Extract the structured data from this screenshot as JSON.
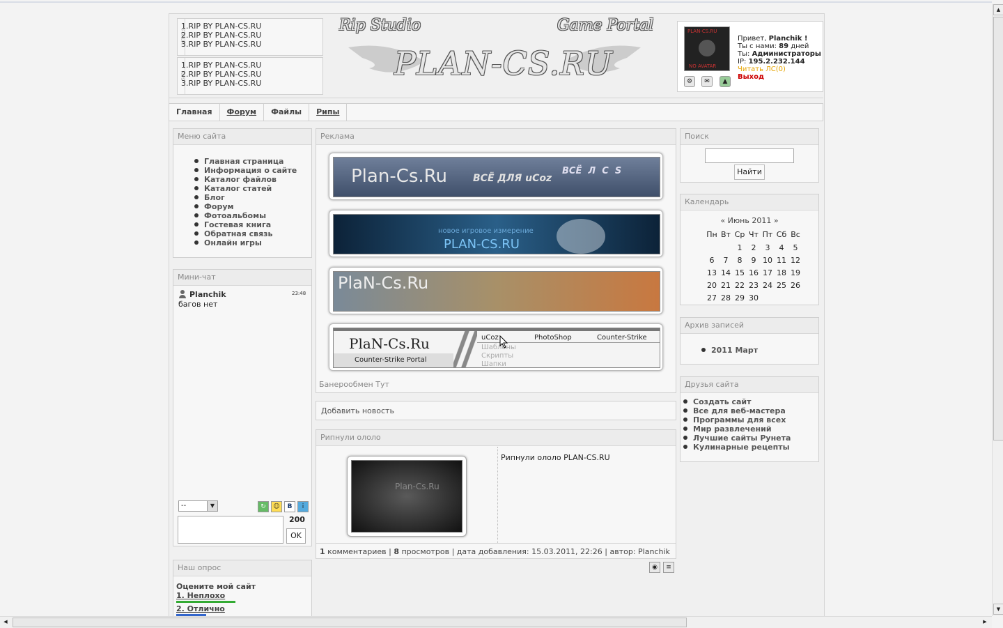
{
  "rip_blocks": [
    {
      "side": "FORUM",
      "lines": [
        "1.RIP BY PLAN-CS.RU",
        "2.RIP BY PLAN-CS.RU",
        "3.RIP BY PLAN-CS.RU"
      ]
    },
    {
      "side": "RIPS",
      "lines": [
        "1.RIP BY PLAN-CS.RU",
        "2.RIP BY PLAN-CS.RU",
        "3.RIP BY PLAN-CS.RU"
      ]
    }
  ],
  "logo": {
    "left": "Rip Studio",
    "right": "Game Portal",
    "main": "PLAN-CS.RU"
  },
  "user": {
    "avatar_top": "PLAN-CS.RU",
    "avatar_bottom": "NO AVATAR",
    "greeting": "Привет,",
    "name": "Planchik !",
    "with_us_label": "Ты с нами:",
    "with_us_days": "89",
    "with_us_unit": "дней",
    "role_label": "Ты:",
    "role": "Администраторы",
    "ip_label": "IP:",
    "ip": "195.2.232.144",
    "read_pm": "Читать ЛС(0)",
    "logout": "Выход"
  },
  "nav": [
    "Главная",
    "Форум",
    "Файлы",
    "Рипы"
  ],
  "site_menu": {
    "title": "Меню сайта",
    "items": [
      "Главная страница",
      "Информация о сайте",
      "Каталог файлов",
      "Каталог статей",
      "Блог",
      "Форум",
      "Фотоальбомы",
      "Гостевая книга",
      "Обратная связь",
      "Онлайн игры"
    ]
  },
  "minichat": {
    "title": "Мини-чат",
    "user": "Planchik",
    "time": "23:48",
    "message": "багов нет",
    "select": "--",
    "counter": "200",
    "ok": "OK"
  },
  "poll": {
    "title": "Наш опрос",
    "question": "Оцените мой сайт",
    "answers": [
      "1. Неплохо",
      "2. Отлично"
    ],
    "bars": [
      0.55,
      0.28
    ]
  },
  "ads": {
    "title": "Реклама",
    "b1_main": "Plan-Cs.Ru",
    "b1_tag": "ВСЁ ДЛЯ uCoz",
    "b1_letters": "ВСЁ  Л  С  S",
    "b2_sub": "новое игровое измерение",
    "b2_main": "PLAN-CS.RU",
    "b3_main": "PlaN-Cs.Ru",
    "b4_main": "PlaN-Cs.Ru",
    "b4_sub": "Counter-Strike Portal",
    "b4_tabs": [
      "uCoz",
      "PhotoShop",
      "Counter-Strike"
    ],
    "b4_list": [
      "Шаблоны",
      "Скрипты",
      "Шапки"
    ],
    "exchange": "Банерообмен Тут"
  },
  "add_news": "Добавить новость",
  "news": {
    "title": "Рипнули ололо",
    "text": "Рипнули ололо PLAN-CS.RU",
    "thumb_text": "Plan-Cs.Ru",
    "comments": "1",
    "comments_label": "комментариев",
    "views": "8",
    "views_label": "просмотров",
    "date_label": "дата добавления:",
    "date": "15.03.2011, 22:26",
    "author_label": "автор:",
    "author": "Planchik"
  },
  "search": {
    "title": "Поиск",
    "button": "Найти",
    "value": ""
  },
  "calendar": {
    "title": "Календарь",
    "prev": "«",
    "month": "Июнь 2011",
    "next": "»",
    "weekdays": [
      "Пн",
      "Вт",
      "Ср",
      "Чт",
      "Пт",
      "Сб",
      "Вс"
    ],
    "weeks": [
      [
        "",
        "",
        "1",
        "2",
        "3",
        "4",
        "5"
      ],
      [
        "6",
        "7",
        "8",
        "9",
        "10",
        "11",
        "12"
      ],
      [
        "13",
        "14",
        "15",
        "16",
        "17",
        "18",
        "19"
      ],
      [
        "20",
        "21",
        "22",
        "23",
        "24",
        "25",
        "26"
      ],
      [
        "27",
        "28",
        "29",
        "30",
        "",
        "",
        ""
      ]
    ]
  },
  "archive": {
    "title": "Архив записей",
    "items": [
      "2011 Март"
    ]
  },
  "friends": {
    "title": "Друзья сайта",
    "items": [
      "Создать сайт",
      "Все для веб-мастера",
      "Программы для всех",
      "Мир развлечений",
      "Лучшие сайты Рунета",
      "Кулинарные рецепты"
    ]
  }
}
